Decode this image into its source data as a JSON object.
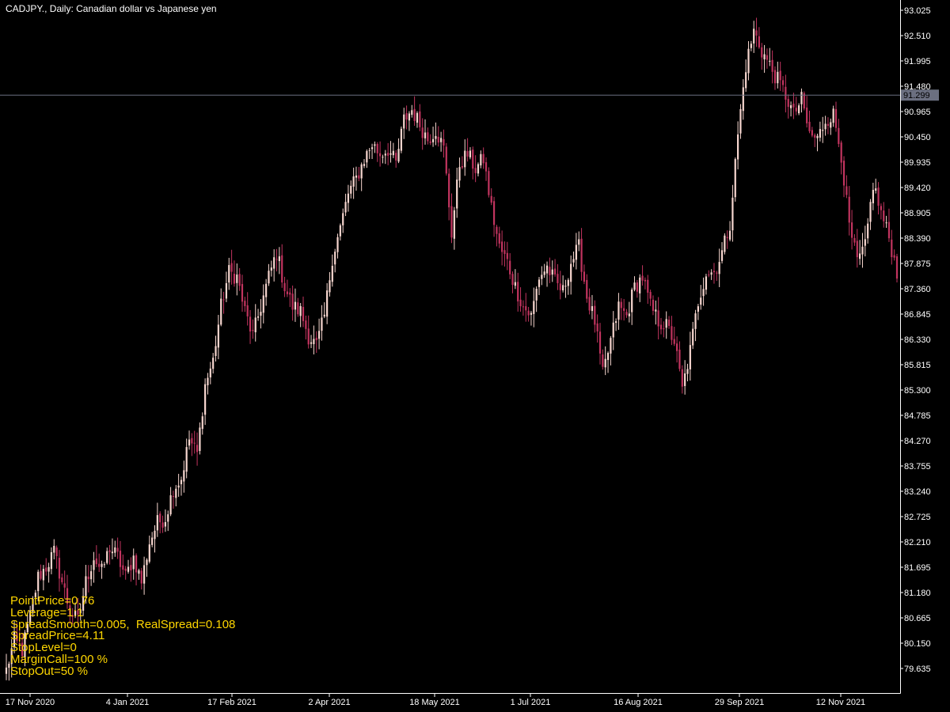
{
  "header": {
    "title": "CADJPY., Daily:  Canadian dollar vs Japanese yen"
  },
  "info_lines": [
    "PointPrice=0.76",
    "Leverage=1:1",
    "SpreadSmooth=0.005,  RealSpread=0.108",
    "SpreadPrice=4.11",
    "StopLevel=0",
    "MarginCall=100 %",
    "StopOut=50 %"
  ],
  "colors": {
    "background": "#000000",
    "axis": "#ffffff",
    "bull": "#f7d6cf",
    "bear": "#c2345f",
    "price_line": "#6b6f80",
    "price_tag": "#6b6f80",
    "info_text": "#ffd700"
  },
  "chart_data": {
    "type": "candlestick",
    "symbol": "CADJPY.",
    "timeframe": "Daily",
    "y_ticks": [
      "93.025",
      "92.510",
      "91.995",
      "91.480",
      "90.965",
      "90.450",
      "89.935",
      "89.420",
      "88.905",
      "88.390",
      "87.875",
      "87.360",
      "86.845",
      "86.330",
      "85.815",
      "85.300",
      "84.785",
      "84.270",
      "83.755",
      "83.240",
      "82.725",
      "82.210",
      "81.695",
      "81.180",
      "80.665",
      "80.150",
      "79.635"
    ],
    "x_ticks": [
      "17 Nov 2020",
      "4 Jan 2021",
      "17 Feb 2021",
      "2 Apr 2021",
      "18 May 2021",
      "1 Jul 2021",
      "16 Aug 2021",
      "29 Sep 2021",
      "12 Nov 2021"
    ],
    "ylim": [
      79.3,
      93.2
    ],
    "current_price": "91.299",
    "close_path": [
      [
        0,
        79.6
      ],
      [
        3,
        80.2
      ],
      [
        6,
        80.0
      ],
      [
        9,
        80.7
      ],
      [
        12,
        81.5
      ],
      [
        15,
        81.7
      ],
      [
        18,
        82.0
      ],
      [
        21,
        81.4
      ],
      [
        24,
        80.8
      ],
      [
        27,
        80.6
      ],
      [
        30,
        81.4
      ],
      [
        33,
        81.9
      ],
      [
        36,
        81.6
      ],
      [
        39,
        82.1
      ],
      [
        42,
        81.9
      ],
      [
        45,
        81.5
      ],
      [
        48,
        81.9
      ],
      [
        51,
        81.4
      ],
      [
        54,
        82.2
      ],
      [
        57,
        82.6
      ],
      [
        60,
        82.7
      ],
      [
        63,
        83.3
      ],
      [
        66,
        83.5
      ],
      [
        69,
        84.3
      ],
      [
        72,
        84.0
      ],
      [
        75,
        85.4
      ],
      [
        78,
        85.9
      ],
      [
        81,
        87.0
      ],
      [
        84,
        87.7
      ],
      [
        87,
        87.6
      ],
      [
        90,
        86.9
      ],
      [
        93,
        86.4
      ],
      [
        96,
        87.0
      ],
      [
        99,
        87.6
      ],
      [
        102,
        88.1
      ],
      [
        105,
        87.4
      ],
      [
        108,
        87.0
      ],
      [
        111,
        86.9
      ],
      [
        114,
        86.4
      ],
      [
        117,
        86.2
      ],
      [
        120,
        86.8
      ],
      [
        123,
        88.0
      ],
      [
        126,
        88.6
      ],
      [
        129,
        89.3
      ],
      [
        132,
        89.6
      ],
      [
        135,
        90.0
      ],
      [
        138,
        90.3
      ],
      [
        141,
        90.1
      ],
      [
        144,
        90.2
      ],
      [
        147,
        89.9
      ],
      [
        150,
        90.8
      ],
      [
        153,
        91.0
      ],
      [
        156,
        90.7
      ],
      [
        159,
        90.4
      ],
      [
        162,
        90.6
      ],
      [
        165,
        90.2
      ],
      [
        168,
        88.5
      ],
      [
        171,
        89.9
      ],
      [
        174,
        90.1
      ],
      [
        177,
        89.8
      ],
      [
        180,
        90.0
      ],
      [
        183,
        89.0
      ],
      [
        186,
        88.2
      ],
      [
        189,
        87.9
      ],
      [
        192,
        87.4
      ],
      [
        195,
        87.0
      ],
      [
        198,
        86.8
      ],
      [
        201,
        87.6
      ],
      [
        204,
        87.8
      ],
      [
        207,
        87.5
      ],
      [
        210,
        87.3
      ],
      [
        213,
        87.9
      ],
      [
        216,
        88.2
      ],
      [
        219,
        87.2
      ],
      [
        222,
        86.7
      ],
      [
        225,
        85.6
      ],
      [
        228,
        86.3
      ],
      [
        231,
        87.0
      ],
      [
        234,
        86.8
      ],
      [
        237,
        87.4
      ],
      [
        240,
        87.6
      ],
      [
        243,
        87.0
      ],
      [
        246,
        86.7
      ],
      [
        249,
        86.6
      ],
      [
        252,
        86.3
      ],
      [
        255,
        85.3
      ],
      [
        258,
        86.1
      ],
      [
        261,
        87.1
      ],
      [
        264,
        87.7
      ],
      [
        267,
        87.7
      ],
      [
        270,
        88.1
      ],
      [
        273,
        88.7
      ],
      [
        276,
        90.5
      ],
      [
        279,
        91.9
      ],
      [
        282,
        92.6
      ],
      [
        285,
        92.2
      ],
      [
        288,
        91.9
      ],
      [
        291,
        91.6
      ],
      [
        294,
        91.3
      ],
      [
        297,
        90.9
      ],
      [
        300,
        91.2
      ],
      [
        303,
        90.5
      ],
      [
        306,
        90.4
      ],
      [
        309,
        90.8
      ],
      [
        312,
        90.9
      ],
      [
        315,
        90.1
      ],
      [
        318,
        88.6
      ],
      [
        321,
        87.9
      ],
      [
        324,
        88.2
      ],
      [
        327,
        89.5
      ],
      [
        330,
        88.9
      ],
      [
        333,
        88.4
      ],
      [
        336,
        87.7
      ]
    ]
  }
}
